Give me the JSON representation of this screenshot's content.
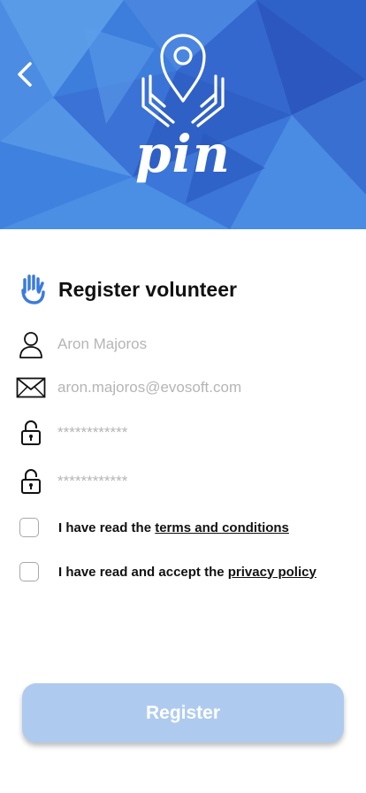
{
  "header": {
    "brand": "pin",
    "back_icon": "chevron-left-icon",
    "logo_icon": "location-pin-hands-icon",
    "colors": {
      "bg_light": "#4d8fe6",
      "bg_dark": "#2a5fc9"
    }
  },
  "form": {
    "title": "Register volunteer",
    "title_icon": "helping-hand-heart-icon",
    "name_field": {
      "placeholder": "Aron Majoros",
      "icon": "user-icon"
    },
    "email_field": {
      "placeholder": "aron.majoros@evosoft.com",
      "icon": "envelope-icon"
    },
    "password_field": {
      "placeholder": "************",
      "icon": "padlock-icon"
    },
    "confirm_password_field": {
      "placeholder": "************",
      "icon": "padlock-icon"
    },
    "terms": {
      "prefix": "I have read the ",
      "link": "terms and conditions",
      "checked": false
    },
    "privacy": {
      "prefix": "I have read and accept the ",
      "link": "privacy policy",
      "checked": false
    },
    "register_label": "Register",
    "register_color": "#aecbef",
    "accent": "#3b7bdc"
  }
}
